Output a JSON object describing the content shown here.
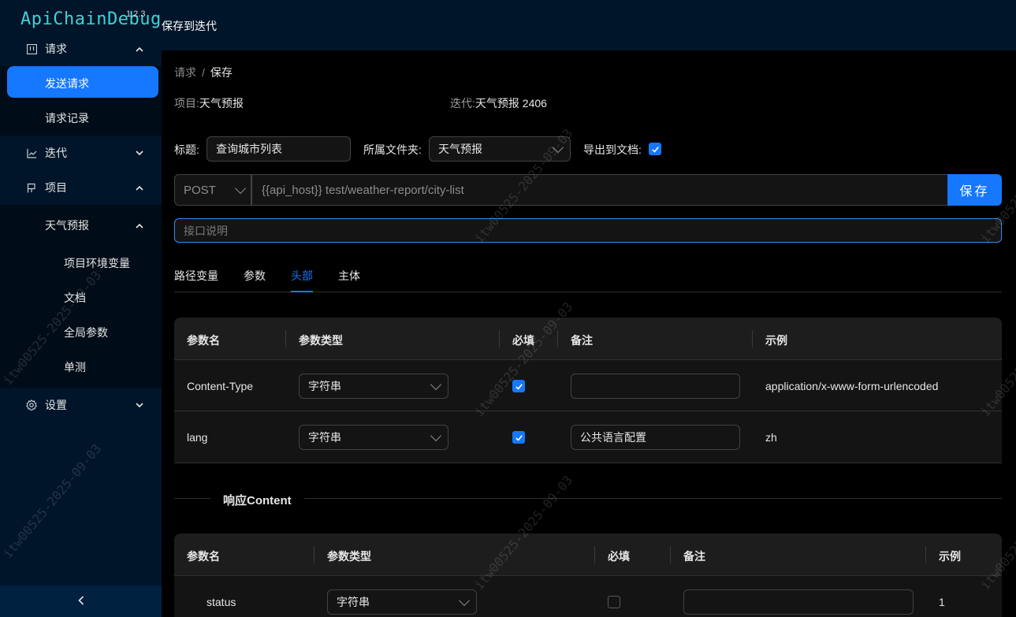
{
  "app": {
    "logo": "ApiChainDebug",
    "version": "1.2.3",
    "top_title": "保存到迭代"
  },
  "sidebar": {
    "request": {
      "label": "请求",
      "icon": "request-icon"
    },
    "send_request": "发送请求",
    "request_history": "请求记录",
    "iteration": {
      "label": "迭代",
      "icon": "chart-icon"
    },
    "project": {
      "label": "项目",
      "icon": "flag-icon"
    },
    "project_weather": "天气预报",
    "project_env": "项目环境变量",
    "docs": "文档",
    "global_params": "全局参数",
    "unit_test": "单测",
    "settings": {
      "label": "设置",
      "icon": "gear-icon"
    },
    "collapse": "<"
  },
  "breadcrumb": {
    "parent": "请求",
    "sep": "/",
    "current": "保存"
  },
  "meta": {
    "project_key": "项目:",
    "project_value": "天气预报",
    "iteration_key": "迭代:",
    "iteration_value": "天气预报 2406"
  },
  "form": {
    "title_label": "标题:",
    "title_value": "查询城市列表",
    "folder_label": "所属文件夹:",
    "folder_value": "天气预报",
    "export_label": "导出到文档:",
    "export_checked": true,
    "method": "POST",
    "url": "{{api_host}} test/weather-report/city-list",
    "save_button": "保存",
    "desc_placeholder": "接口说明"
  },
  "tabs": [
    {
      "label": "路径变量"
    },
    {
      "label": "参数"
    },
    {
      "label": "头部",
      "active": true
    },
    {
      "label": "主体"
    }
  ],
  "headers_table": {
    "columns": [
      "参数名",
      "参数类型",
      "必填",
      "备注",
      "示例"
    ],
    "rows": [
      {
        "name": "Content-Type",
        "type": "字符串",
        "required": true,
        "note": "",
        "example": "application/x-www-form-urlencoded"
      },
      {
        "name": "lang",
        "type": "字符串",
        "required": true,
        "note": "公共语言配置",
        "example": "zh"
      }
    ]
  },
  "response_section": {
    "title": "响应Content"
  },
  "response_table": {
    "columns": [
      "参数名",
      "参数类型",
      "必填",
      "备注",
      "示例"
    ],
    "rows": [
      {
        "name": "status",
        "type": "字符串",
        "required": false,
        "note": "",
        "example": "1"
      }
    ]
  },
  "watermark": "itw00525-2025-09-03"
}
